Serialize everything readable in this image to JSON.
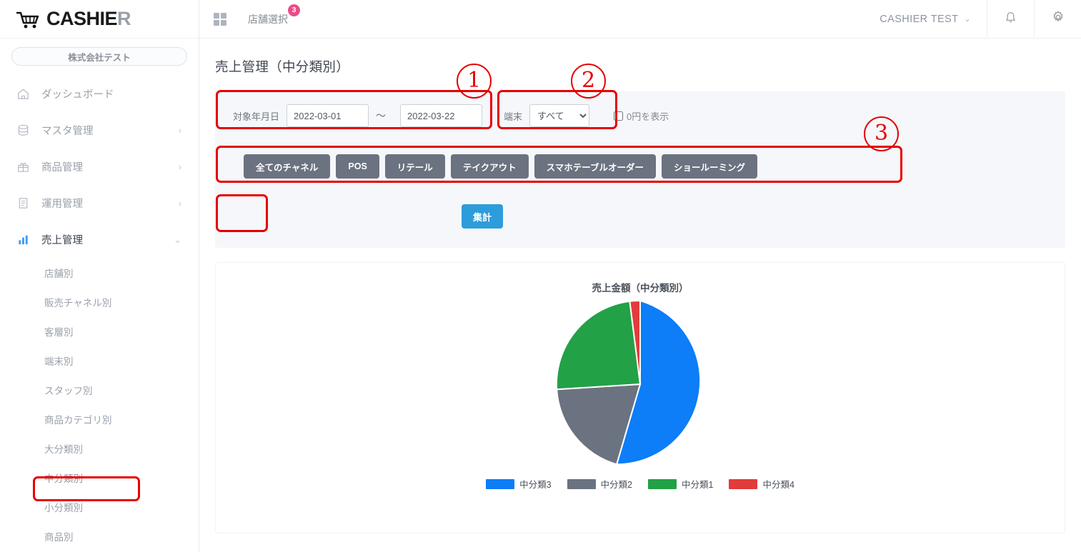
{
  "brand": {
    "name_main": "CASHIE",
    "name_accent": "R",
    "cart_icon": "shopping-cart-icon"
  },
  "sidebar": {
    "company": "株式会社テスト",
    "items": [
      {
        "label": "ダッシュボード",
        "icon": "home-icon",
        "chevron": ""
      },
      {
        "label": "マスタ管理",
        "icon": "database-icon",
        "chevron": "›"
      },
      {
        "label": "商品管理",
        "icon": "gift-icon",
        "chevron": "›"
      },
      {
        "label": "運用管理",
        "icon": "clipboard-icon",
        "chevron": "›"
      },
      {
        "label": "売上管理",
        "icon": "bar-chart-icon",
        "chevron": "⌄"
      }
    ],
    "subitems": [
      {
        "label": "店舗別"
      },
      {
        "label": "販売チャネル別"
      },
      {
        "label": "客層別"
      },
      {
        "label": "端末別"
      },
      {
        "label": "スタッフ別"
      },
      {
        "label": "商品カテゴリ別"
      },
      {
        "label": "大分類別"
      },
      {
        "label": "中分類別"
      },
      {
        "label": "小分類別"
      },
      {
        "label": "商品別"
      }
    ]
  },
  "topbar": {
    "grid_icon": "grid-icon",
    "store_select_label": "店舗選択",
    "store_badge_count": "3",
    "user_name": "CASHIER  TEST",
    "user_caret": "⌄",
    "bell_icon": "bell-icon",
    "gear_icon": "gear-icon"
  },
  "page": {
    "title": "売上管理（中分類別）"
  },
  "filters": {
    "date_label": "対象年月日",
    "date_from": "2022-03-01",
    "date_to": "2022-03-22",
    "date_separator": "〜",
    "terminal_label": "端末",
    "terminal_value": "すべて",
    "terminal_options": [
      "すべて"
    ],
    "zero_yen_label": "0円を表示",
    "zero_yen_checked": false,
    "channels": [
      {
        "label": "全てのチャネル"
      },
      {
        "label": "POS"
      },
      {
        "label": "リテール"
      },
      {
        "label": "テイクアウト"
      },
      {
        "label": "スマホテーブルオーダー"
      },
      {
        "label": "ショールーミング"
      }
    ],
    "aggregate_button": "集計"
  },
  "annotations": [
    {
      "number": "①"
    },
    {
      "number": "②"
    },
    {
      "number": "③"
    }
  ],
  "chart_data": {
    "type": "pie",
    "title": "売上金額（中分類別）",
    "categories": [
      "中分類3",
      "中分類2",
      "中分類1",
      "中分類4"
    ],
    "values": [
      54.5,
      21.5,
      22.0,
      2.0
    ],
    "colors": [
      "#0d7df8",
      "#6b7280",
      "#22a146",
      "#e23b3b"
    ],
    "legend_position": "bottom",
    "legend": [
      {
        "label": "中分類3",
        "color": "#0d7df8"
      },
      {
        "label": "中分類2",
        "color": "#6b7280"
      },
      {
        "label": "中分類1",
        "color": "#22a146"
      },
      {
        "label": "中分類4",
        "color": "#e23b3b"
      }
    ]
  },
  "theme": {
    "accent_blue": "#2d9cdb",
    "channel_gray": "#6b7280",
    "highlight_red": "#e60000",
    "badge_pink": "#ea4c89",
    "panel_bg": "#f5f7fa"
  }
}
